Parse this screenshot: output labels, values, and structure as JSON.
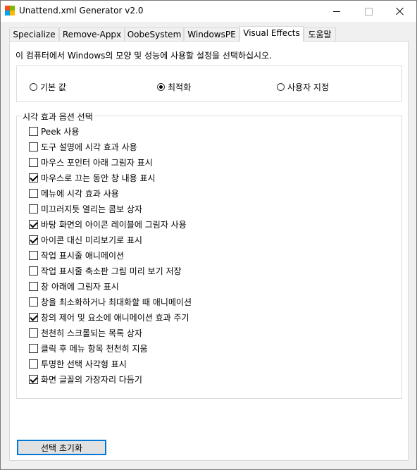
{
  "window": {
    "title": "Unattend.xml Generator v2.0",
    "icons": {
      "app": "windows-logo-icon",
      "minimize": "minimize-icon",
      "maximize": "maximize-icon",
      "close": "close-icon"
    }
  },
  "tabs": [
    {
      "label": "Specialize",
      "active": false
    },
    {
      "label": "Remove-Appx",
      "active": false
    },
    {
      "label": "OobeSystem",
      "active": false
    },
    {
      "label": "WindowsPE",
      "active": false
    },
    {
      "label": "Visual Effects",
      "active": true
    },
    {
      "label": "도움말",
      "active": false
    }
  ],
  "panel": {
    "description": "이 컴퓨터에서 Windows의 모양 및 성능에 사용할 설정을 선택하십시오.",
    "presets": [
      {
        "label": "기본 값",
        "checked": false
      },
      {
        "label": "최적화",
        "checked": true
      },
      {
        "label": "사용자 지정",
        "checked": false
      }
    ],
    "effects_group_title": "시각 효과 옵션 선택",
    "effects": [
      {
        "label": "Peek 사용",
        "checked": false
      },
      {
        "label": "도구 설명에 시각 효과 사용",
        "checked": false
      },
      {
        "label": "마우스 포인터 아래 그림자 표시",
        "checked": false
      },
      {
        "label": "마우스로 끄는 동안 창 내용 표시",
        "checked": true
      },
      {
        "label": "메뉴에 시각 효과 사용",
        "checked": false
      },
      {
        "label": "미끄러지듯 열리는 콤보 상자",
        "checked": false
      },
      {
        "label": "바탕 화면의 아이콘 레이블에 그림자 사용",
        "checked": true
      },
      {
        "label": "아이콘 대신 미리보기로 표시",
        "checked": true
      },
      {
        "label": "작업 표시줄 애니메이션",
        "checked": false
      },
      {
        "label": "작업 표시줄 축소판 그림 미리 보기 저장",
        "checked": false
      },
      {
        "label": "창 아래에 그림자 표시",
        "checked": false
      },
      {
        "label": "창을 최소화하거나 최대화할 때 애니메이션",
        "checked": false
      },
      {
        "label": "창의 제어 및 요소에 애니메이션 효과 주기",
        "checked": true
      },
      {
        "label": "천천히 스크롤되는 목록 상자",
        "checked": false
      },
      {
        "label": "클릭 후 메뉴 항목 천천히 지움",
        "checked": false
      },
      {
        "label": "투명한 선택 사각형 표시",
        "checked": false
      },
      {
        "label": "화면 글꼴의 가장자리 다듬기",
        "checked": true
      }
    ],
    "reset_label": "선택 초기화"
  }
}
